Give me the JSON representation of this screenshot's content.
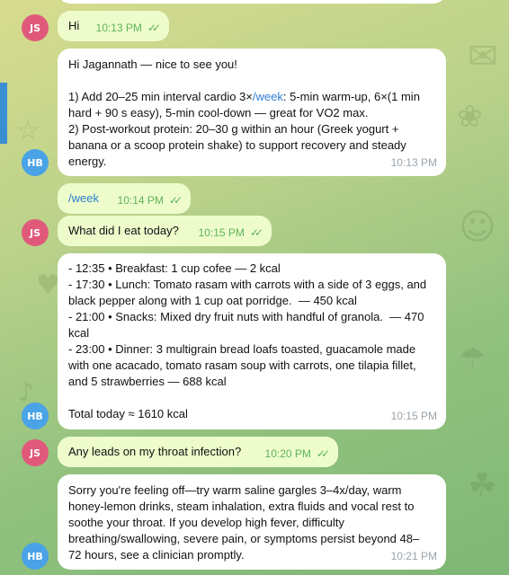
{
  "messages": [
    {
      "sender": "JS",
      "text": "Hi",
      "time": "10:13 PM",
      "read": true
    },
    {
      "sender": "HB",
      "text": "Hi Jagannath — nice to see you!\n\n1) Add 20–25 min interval cardio 3×/week: 5-min warm-up, 6×(1 min\nhard + 90 s easy), 5-min cool-down — great for VO2 max.\n2) Post-workout protein: 20–30 g within an hour (Greek yogurt +\nbanana or a scoop protein shake) to support recovery and steady\nenergy.",
      "time": "10:13 PM"
    },
    {
      "sender": "JS",
      "text": "/week",
      "time": "10:14 PM",
      "read": true
    },
    {
      "sender": "JS",
      "text": "What did I eat today?",
      "time": "10:15 PM",
      "read": true
    },
    {
      "sender": "HB",
      "text": "- 12:35 • Breakfast: 1 cup cofee — 2 kcal\n- 17:30 • Lunch: Tomato rasam with carrots with a side of 3 eggs, and\nblack pepper along with 1 cup oat porridge.  — 450 kcal\n- 21:00 • Snacks: Mixed dry fruit nuts with handful of granola.  — 470\nkcal\n- 23:00 • Dinner: 3 multigrain bread loafs toasted, guacamole made\nwith one acacado, tomato rasam soup with carrots, one tilapia fillet,\nand 5 strawberries — 688 kcal\n\nTotal today ≈ 1610 kcal",
      "time": "10:15 PM"
    },
    {
      "sender": "JS",
      "text": "Any leads on my throat infection?",
      "time": "10:20 PM",
      "read": true
    },
    {
      "sender": "HB",
      "text": "Sorry you're feeling off—try warm saline gargles 3–4x/day, warm\nhoney-lemon drinks, steam inhalation, extra fluids and vocal rest to\nsoothe your throat. If you develop high fever, difficulty\nbreathing/swallowing, severe pain, or symptoms persist beyond 48–\n72 hours, see a clinician promptly.",
      "time": "10:21 PM"
    }
  ],
  "avatars": {
    "user": "JS",
    "bot": "HB"
  },
  "colors": {
    "outgoing_bubble": "#eefccc",
    "incoming_bubble": "#ffffff",
    "link": "#2b7fd0",
    "check": "#5eb35a"
  }
}
